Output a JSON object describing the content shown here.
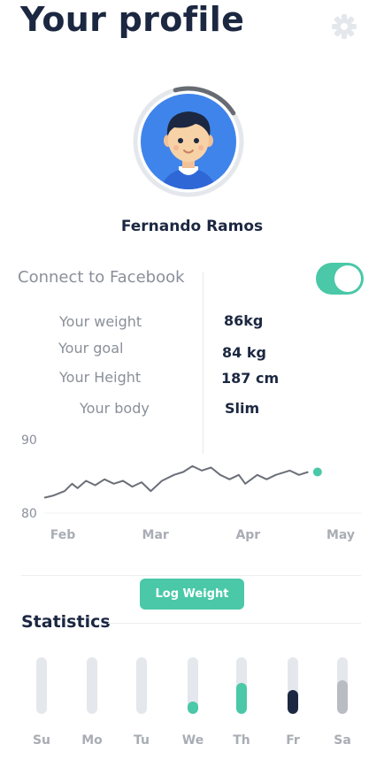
{
  "header": {
    "title": "Your profile",
    "settings_icon": "gear-icon"
  },
  "profile": {
    "name": "Fernando Ramos",
    "avatar_icon": "avatar-boy-icon",
    "ring_progress": 0.2
  },
  "facebook": {
    "label": "Connect to Facebook",
    "connected": true
  },
  "stats_list": [
    {
      "label": "Your weight",
      "value": "86kg"
    },
    {
      "label": "Your goal",
      "value": "84 kg"
    },
    {
      "label": "Your Height",
      "value": "187 cm"
    },
    {
      "label": "Your body",
      "value": "Slim"
    }
  ],
  "chart_data": {
    "type": "line",
    "ylim": [
      80,
      90
    ],
    "y_ticks": [
      "90",
      "80"
    ],
    "x_ticks": [
      "Feb",
      "Mar",
      "Apr",
      "May"
    ],
    "x_range": [
      0,
      3
    ],
    "series": [
      {
        "points": [
          [
            -0.2,
            82.1
          ],
          [
            -0.1,
            82.4
          ],
          [
            0.02,
            83.0
          ],
          [
            0.1,
            84.0
          ],
          [
            0.16,
            83.4
          ],
          [
            0.25,
            84.4
          ],
          [
            0.35,
            83.8
          ],
          [
            0.45,
            84.6
          ],
          [
            0.55,
            84.0
          ],
          [
            0.65,
            84.4
          ],
          [
            0.75,
            83.6
          ],
          [
            0.85,
            84.2
          ],
          [
            0.95,
            83.0
          ],
          [
            1.07,
            84.4
          ],
          [
            1.2,
            85.2
          ],
          [
            1.3,
            85.6
          ],
          [
            1.4,
            86.4
          ],
          [
            1.5,
            85.8
          ],
          [
            1.6,
            86.2
          ],
          [
            1.7,
            85.2
          ],
          [
            1.8,
            84.6
          ],
          [
            1.9,
            85.2
          ],
          [
            1.97,
            84.0
          ],
          [
            2.1,
            85.2
          ],
          [
            2.2,
            84.6
          ],
          [
            2.3,
            85.2
          ],
          [
            2.45,
            85.8
          ],
          [
            2.55,
            85.2
          ],
          [
            2.65,
            85.6
          ]
        ],
        "last_point": [
          2.75,
          85.6
        ]
      }
    ],
    "line_color": "#6b6f78",
    "marker_color": "#4ac8a8"
  },
  "log_button": {
    "label": "Log Weight"
  },
  "statistics": {
    "title": "Statistics",
    "days": [
      {
        "label": "Su",
        "level": 0,
        "color": "#4ac8a8"
      },
      {
        "label": "Mo",
        "level": 0,
        "color": "#4ac8a8"
      },
      {
        "label": "Tu",
        "level": 0,
        "color": "#4ac8a8"
      },
      {
        "label": "We",
        "level": 0.22,
        "color": "#4ac8a8"
      },
      {
        "label": "Th",
        "level": 0.55,
        "color": "#4ac8a8"
      },
      {
        "label": "Fr",
        "level": 0.42,
        "color": "#1c2741"
      },
      {
        "label": "Sa",
        "level": 0.6,
        "color": "#b9bcc2"
      }
    ]
  },
  "colors": {
    "accent": "#4ac8a8",
    "dark": "#1c2741",
    "muted": "#8a8f99"
  }
}
